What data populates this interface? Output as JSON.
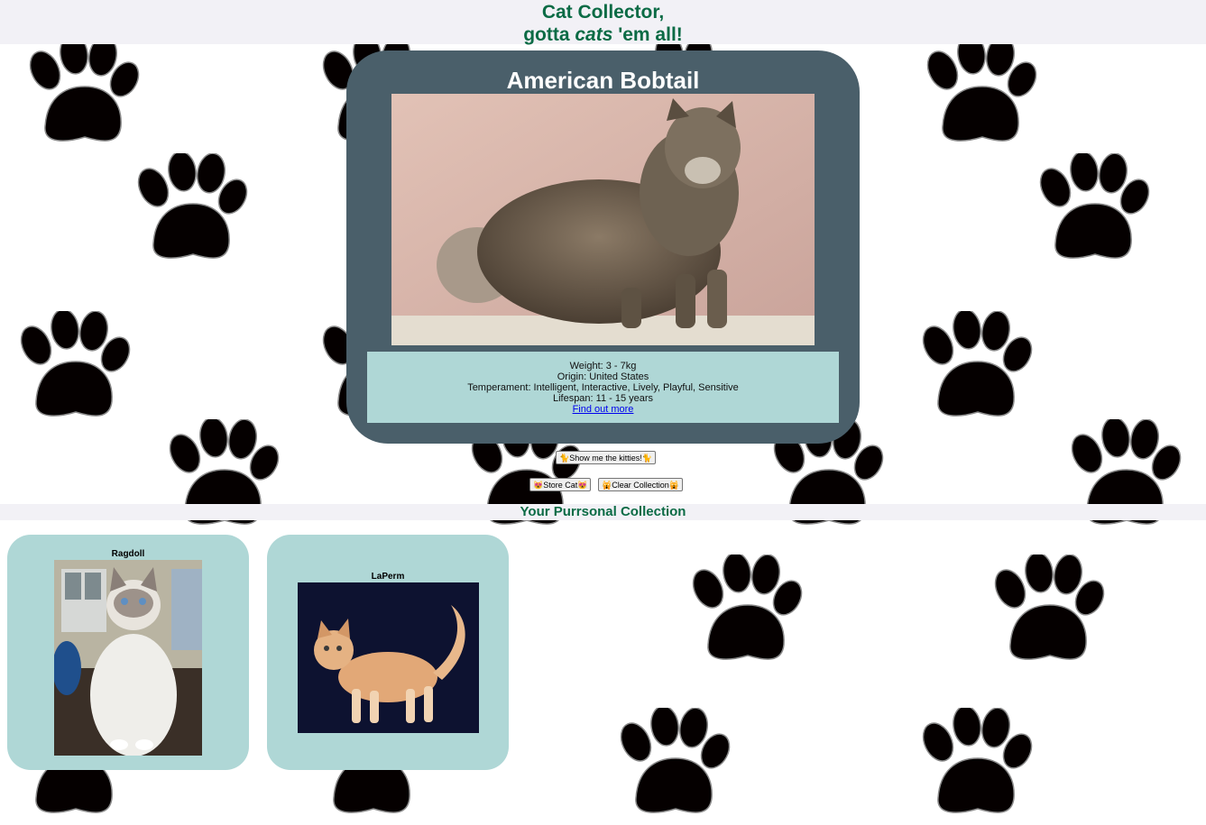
{
  "header": {
    "title_line1": "Cat Collector,",
    "title_line2_prefix": "gotta",
    "title_line2_emph": "cats",
    "title_line2_suffix": "'em all!"
  },
  "current_cat": {
    "name": "American Bobtail",
    "weight": "Weight: 3 - 7kg",
    "origin": "Origin: United States",
    "temperament": "Temperament: Intelligent, Interactive, Lively, Playful, Sensitive",
    "lifespan": "Lifespan: 11 - 15 years",
    "link_text": "Find out more"
  },
  "buttons": {
    "show_kitties": "Show me the kitties!",
    "store_cat": "Store Cat",
    "clear_collection": "Clear Collection"
  },
  "collection": {
    "heading": "Your Purrsonal Collection",
    "cats": [
      {
        "name": "Ragdoll"
      },
      {
        "name": "LaPerm"
      }
    ]
  },
  "colors": {
    "accent_green": "#0b6b45",
    "card_slate": "#4a5f6a",
    "panel_teal": "#afd7d6",
    "bar_grey": "#f2f1f6"
  }
}
